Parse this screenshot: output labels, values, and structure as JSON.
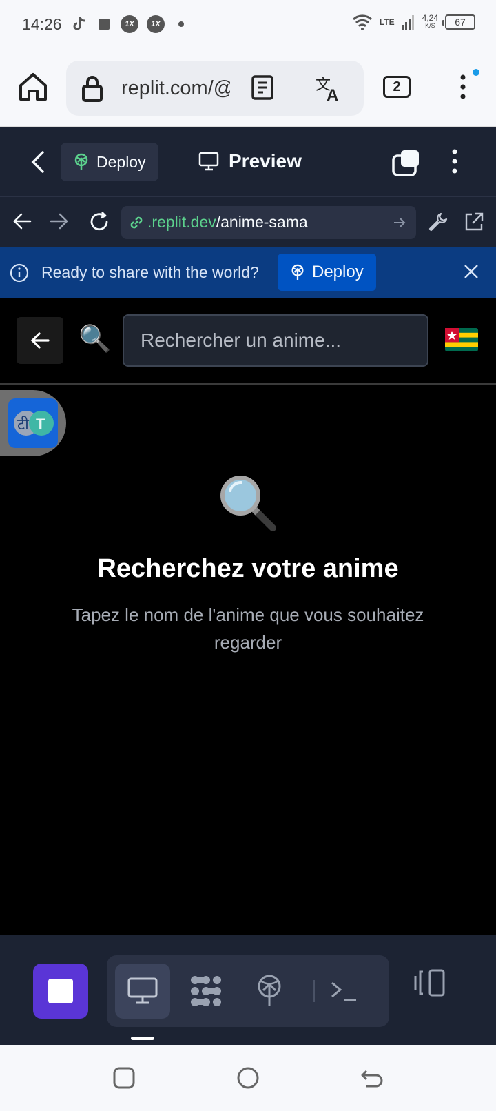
{
  "status_bar": {
    "time": "14:26",
    "network": "LTE",
    "speed_value": "4,24",
    "speed_unit": "K/S",
    "battery": "67"
  },
  "browser": {
    "url": "replit.com/@",
    "tab_count": "2",
    "notification_color": "#1a9be8"
  },
  "replit_header": {
    "deploy_label": "Deploy",
    "preview_label": "Preview"
  },
  "replit_urlbar": {
    "url_domain": ".replit.dev",
    "url_path": "/anime-sama"
  },
  "banner": {
    "message": "Ready to share with the world?",
    "deploy_label": "Deploy",
    "background": "#0b3c82"
  },
  "app": {
    "search_placeholder": "Rechercher un anime...",
    "empty_icon": "🔍",
    "search_icon": "🔍",
    "empty_title": "Recherchez votre anime",
    "empty_subtitle": "Tapez le nom de l'anime que vous souhaitez regarder",
    "flag": "togo-flag-icon"
  },
  "floating_translate": {
    "letters": [
      "टी",
      "T"
    ]
  },
  "replit_bottom": {
    "stop_color": "#5a35d6",
    "tools": [
      "preview-icon",
      "extensions-icon",
      "deploy-icon",
      "shell-icon"
    ]
  }
}
